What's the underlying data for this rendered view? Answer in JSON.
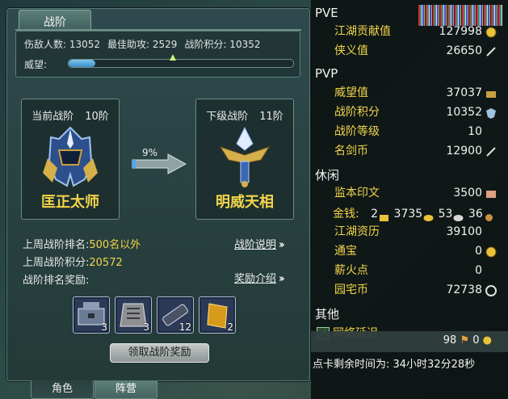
{
  "panel": {
    "title": "战阶",
    "stats": {
      "kills": "伤敌人数: 13052",
      "assists": "最佳助攻: 2529",
      "points": "战阶积分: 10352"
    },
    "prestige_label": "威望:",
    "prestige_progress": 0.12,
    "current": {
      "header": "当前战阶",
      "level": "10阶",
      "name": "匡正太师"
    },
    "next": {
      "header": "下级战阶",
      "level": "11阶",
      "name": "明威天相"
    },
    "progress_pct": "9%",
    "last_week_rank_label": "上周战阶排名:",
    "last_week_rank_value": "500名以外",
    "last_week_points_label": "上周战阶积分:",
    "last_week_points_value": "20572",
    "reward_label": "战阶排名奖励:",
    "help_link": "战阶说明",
    "reward_link": "奖励介绍",
    "rewards": [
      {
        "icon": "chest-icon",
        "count": "3"
      },
      {
        "icon": "armor-icon",
        "count": "3"
      },
      {
        "icon": "scroll-icon",
        "count": "12"
      },
      {
        "icon": "gold-block-icon",
        "count": "2"
      }
    ],
    "claim_button": "领取战阶奖励",
    "tabs": [
      "角色",
      "阵营"
    ]
  },
  "overlay": {
    "pve": {
      "title": "PVE",
      "rows": [
        {
          "label": "江湖贡献值",
          "value": "127998",
          "icon": "coin-icon"
        },
        {
          "label": "侠义值",
          "value": "26650",
          "icon": "sword-icon"
        }
      ]
    },
    "pvp": {
      "title": "PVP",
      "rows": [
        {
          "label": "威望值",
          "value": "37037",
          "icon": "chest-icon"
        },
        {
          "label": "战阶积分",
          "value": "10352",
          "icon": "shield-icon"
        },
        {
          "label": "战阶等级",
          "value": "10",
          "icon": ""
        },
        {
          "label": "名剑币",
          "value": "12900",
          "icon": "sword-icon"
        }
      ]
    },
    "leisure": {
      "title": "休闲",
      "rows": [
        {
          "label": "监本印文",
          "value": "3500",
          "icon": "seal-icon"
        }
      ],
      "money_label": "金钱:",
      "money": [
        "2",
        "3735",
        "53",
        "36"
      ],
      "rows2": [
        {
          "label": "江湖资历",
          "value": "39100",
          "icon": ""
        },
        {
          "label": "通宝",
          "value": "0",
          "icon": "coin-icon"
        },
        {
          "label": "薪火点",
          "value": "0",
          "icon": ""
        },
        {
          "label": "园宅币",
          "value": "72738",
          "icon": "house-coin-icon"
        }
      ]
    },
    "other": {
      "title": "其他",
      "check_label": "网络延迟"
    },
    "footer": {
      "count1": "98",
      "count2": "0",
      "time": "点卡剩余时间为: 34小时32分28秒"
    },
    "colors": {
      "label": "#f2d54a",
      "value": "#f2f2f2"
    }
  }
}
